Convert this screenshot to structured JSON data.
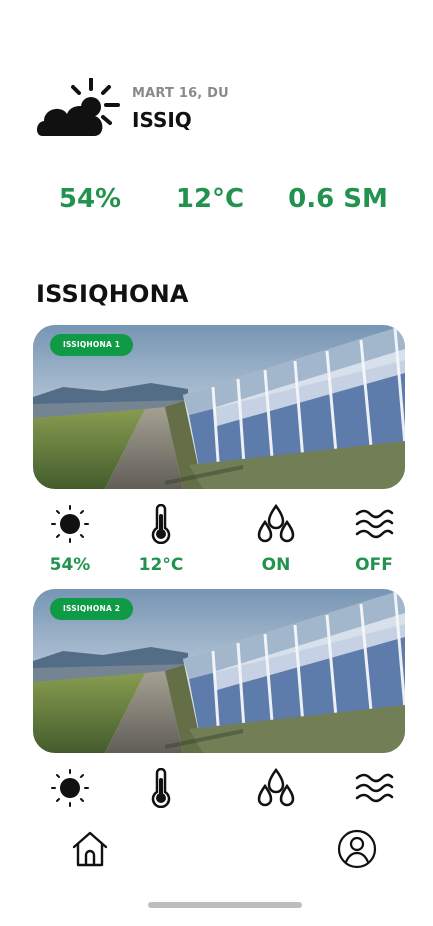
{
  "header": {
    "weather_icon": "partly-cloudy-icon",
    "date": "MART 16, DU",
    "weather": "ISSIQ"
  },
  "metrics": {
    "humidity": "54%",
    "temperature": "12°C",
    "wind": "0.6 SM"
  },
  "section": {
    "title": "ISSIQHONA"
  },
  "greenhouses": [
    {
      "label": "ISSIQHONA 1",
      "sensors": {
        "sun": "54%",
        "temperature": "12°C",
        "water": "ON",
        "wind": "OFF"
      }
    },
    {
      "label": "ISSIQHONA 2"
    }
  ],
  "nav": {
    "home_icon": "home-icon",
    "profile_icon": "profile-icon"
  },
  "colors": {
    "accent_green": "#22924f",
    "badge_green": "#0f9a46",
    "text_dark": "#111111",
    "muted_gray": "#8a8a8a"
  }
}
